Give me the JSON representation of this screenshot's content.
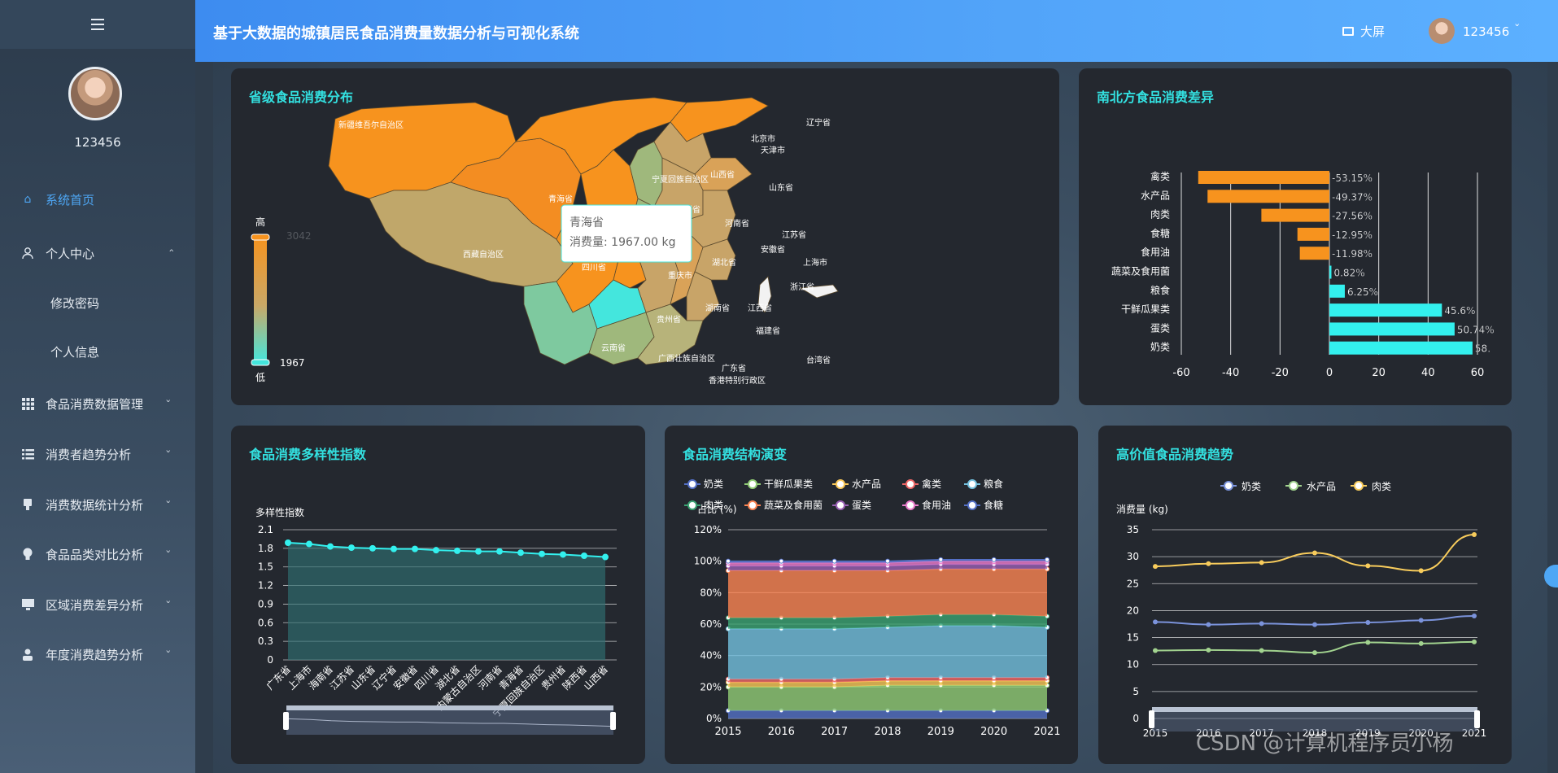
{
  "app": {
    "title": "基于大数据的城镇居民食品消费量数据分析与可视化系统"
  },
  "header": {
    "bigscreen_label": "大屏",
    "username": "123456"
  },
  "sidebar": {
    "username": "123456",
    "items": [
      {
        "label": "系统首页",
        "icon": "home-icon"
      },
      {
        "label": "个人中心",
        "icon": "user-icon"
      },
      {
        "label": "修改密码"
      },
      {
        "label": "个人信息"
      },
      {
        "label": "食品消费数据管理",
        "icon": "grid-icon"
      },
      {
        "label": "消费者趋势分析",
        "icon": "list-icon"
      },
      {
        "label": "消费数据统计分析",
        "icon": "stamp-icon"
      },
      {
        "label": "食品品类对比分析",
        "icon": "bulb-icon"
      },
      {
        "label": "区域消费差异分析",
        "icon": "monitor-icon"
      },
      {
        "label": "年度消费趋势分析",
        "icon": "person-icon"
      }
    ]
  },
  "colors": {
    "accent": "#33e0e0",
    "header": "#4a9cf6",
    "orange": "#f7931e",
    "cyan": "#33f0ee"
  },
  "panels": {
    "map": {
      "title": "省级食品消费分布",
      "legend_high": "高",
      "legend_low": "低",
      "legend_max": "3042",
      "legend_min": "1967",
      "tooltip_title": "青海省",
      "tooltip_value": "消费量: 1967.00 kg",
      "provinces": [
        "新疆维吾尔自治区",
        "西藏自治区",
        "青海省",
        "四川省",
        "云南省",
        "宁夏回族自治区",
        "陕西省",
        "山西省",
        "北京市",
        "天津市",
        "辽宁省",
        "山东省",
        "河南省",
        "江苏省",
        "安徽省",
        "上海市",
        "湖北省",
        "重庆市",
        "浙江省",
        "湖南省",
        "江西省",
        "贵州省",
        "福建省",
        "广西壮族自治区",
        "广东省",
        "香港特别行政区",
        "台湾省"
      ]
    },
    "northsouth": {
      "title": "南北方食品消费差异"
    },
    "diversity": {
      "title": "食品消费多样性指数"
    },
    "structure": {
      "title": "食品消费结构演变"
    },
    "highvalue": {
      "title": "高价值食品消费趋势"
    }
  },
  "chart_data": [
    {
      "type": "bar",
      "orientation": "horizontal",
      "categories": [
        "禽类",
        "水产品",
        "肉类",
        "食糖",
        "食用油",
        "蔬菜及食用菌",
        "粮食",
        "干鲜瓜果类",
        "蛋类",
        "奶类"
      ],
      "values": [
        -53.15,
        -49.37,
        -27.56,
        -12.95,
        -11.98,
        0.82,
        6.25,
        45.6,
        50.74,
        58
      ],
      "labels": [
        "-53.15%",
        "-49.37%",
        "-27.56%",
        "-12.95%",
        "-11.98%",
        "0.82%",
        "6.25%",
        "45.6%",
        "50.74%",
        "58."
      ],
      "xlim": [
        -60,
        60
      ],
      "xticks": [
        -60,
        -40,
        -20,
        0,
        20,
        40,
        60
      ],
      "grid": true
    },
    {
      "type": "area",
      "ylabel": "多样性指数",
      "categories": [
        "广东省",
        "上海市",
        "海南省",
        "江苏省",
        "山东省",
        "辽宁省",
        "安徽省",
        "四川省",
        "湖北省",
        "内蒙古自治区",
        "河南省",
        "青海省",
        "宁夏回族自治区",
        "贵州省",
        "陕西省",
        "山西省"
      ],
      "values": [
        1.89,
        1.87,
        1.83,
        1.81,
        1.8,
        1.79,
        1.79,
        1.77,
        1.76,
        1.75,
        1.75,
        1.73,
        1.71,
        1.7,
        1.68,
        1.66
      ],
      "ylim": [
        0,
        2.1
      ],
      "yticks": [
        "0",
        "0.3",
        "0.6",
        "0.9",
        "1.2",
        "1.5",
        "1.8",
        "2.1"
      ],
      "dataZoom": true
    },
    {
      "type": "area",
      "stacked": true,
      "ylabel": "占比 (%)",
      "x": [
        "2015",
        "2016",
        "2017",
        "2018",
        "2019",
        "2020",
        "2021"
      ],
      "yticks": [
        "0%",
        "20%",
        "40%",
        "60%",
        "80%",
        "100%",
        "120%"
      ],
      "ylim": [
        0,
        120
      ],
      "legend": [
        "奶类",
        "干鲜瓜果类",
        "水产品",
        "禽类",
        "粮食",
        "肉类",
        "蔬菜及食用菌",
        "蛋类",
        "食用油",
        "食糖"
      ],
      "series_colors": [
        "#5470c6",
        "#91cc75",
        "#fac858",
        "#ee6666",
        "#73c0de",
        "#3ba272",
        "#fc8452",
        "#9a60b4",
        "#ea7ccc",
        "#5470c6"
      ],
      "series": [
        {
          "name": "奶类",
          "values": [
            5,
            5,
            5,
            5,
            5,
            5,
            5
          ]
        },
        {
          "name": "干鲜瓜果类",
          "values": [
            15,
            15,
            15,
            16,
            16,
            16,
            16
          ]
        },
        {
          "name": "水产品",
          "values": [
            3,
            3,
            3,
            3,
            3,
            3,
            3
          ]
        },
        {
          "name": "禽类",
          "values": [
            2,
            2,
            2,
            2,
            2,
            2,
            2
          ]
        },
        {
          "name": "粮食",
          "values": [
            32,
            32,
            32,
            32,
            33,
            33,
            32
          ]
        },
        {
          "name": "肉类",
          "values": [
            7,
            7,
            7,
            7,
            7,
            7,
            7
          ]
        },
        {
          "name": "蔬菜及食用菌",
          "values": [
            30,
            30,
            30,
            29,
            29,
            29,
            30
          ]
        },
        {
          "name": "蛋类",
          "values": [
            3,
            3,
            3,
            3,
            3,
            3,
            3
          ]
        },
        {
          "name": "食用油",
          "values": [
            2,
            2,
            2,
            2,
            2,
            2,
            2
          ]
        },
        {
          "name": "食糖",
          "values": [
            1,
            1,
            1,
            1,
            1,
            1,
            1
          ]
        }
      ]
    },
    {
      "type": "line",
      "ylabel": "消费量 (kg)",
      "x": [
        "2015",
        "2016",
        "2017",
        "2018",
        "2019",
        "2020",
        "2021"
      ],
      "ylim": [
        0,
        35
      ],
      "yticks": [
        "0",
        "5",
        "10",
        "15",
        "20",
        "25",
        "30",
        "35"
      ],
      "series": [
        {
          "name": "奶类",
          "values": [
            17.9,
            17.4,
            17.6,
            17.4,
            17.8,
            18.2,
            19.0
          ],
          "color": "#7b93db"
        },
        {
          "name": "水产品",
          "values": [
            12.6,
            12.7,
            12.6,
            12.2,
            14.1,
            13.9,
            14.2
          ],
          "color": "#a2d38f"
        },
        {
          "name": "肉类",
          "values": [
            28.2,
            28.7,
            28.9,
            30.7,
            28.3,
            27.4,
            34.1
          ],
          "color": "#f8cc5c"
        }
      ],
      "dataZoom": true
    }
  ],
  "watermark": "CSDN @计算机程序员小杨"
}
